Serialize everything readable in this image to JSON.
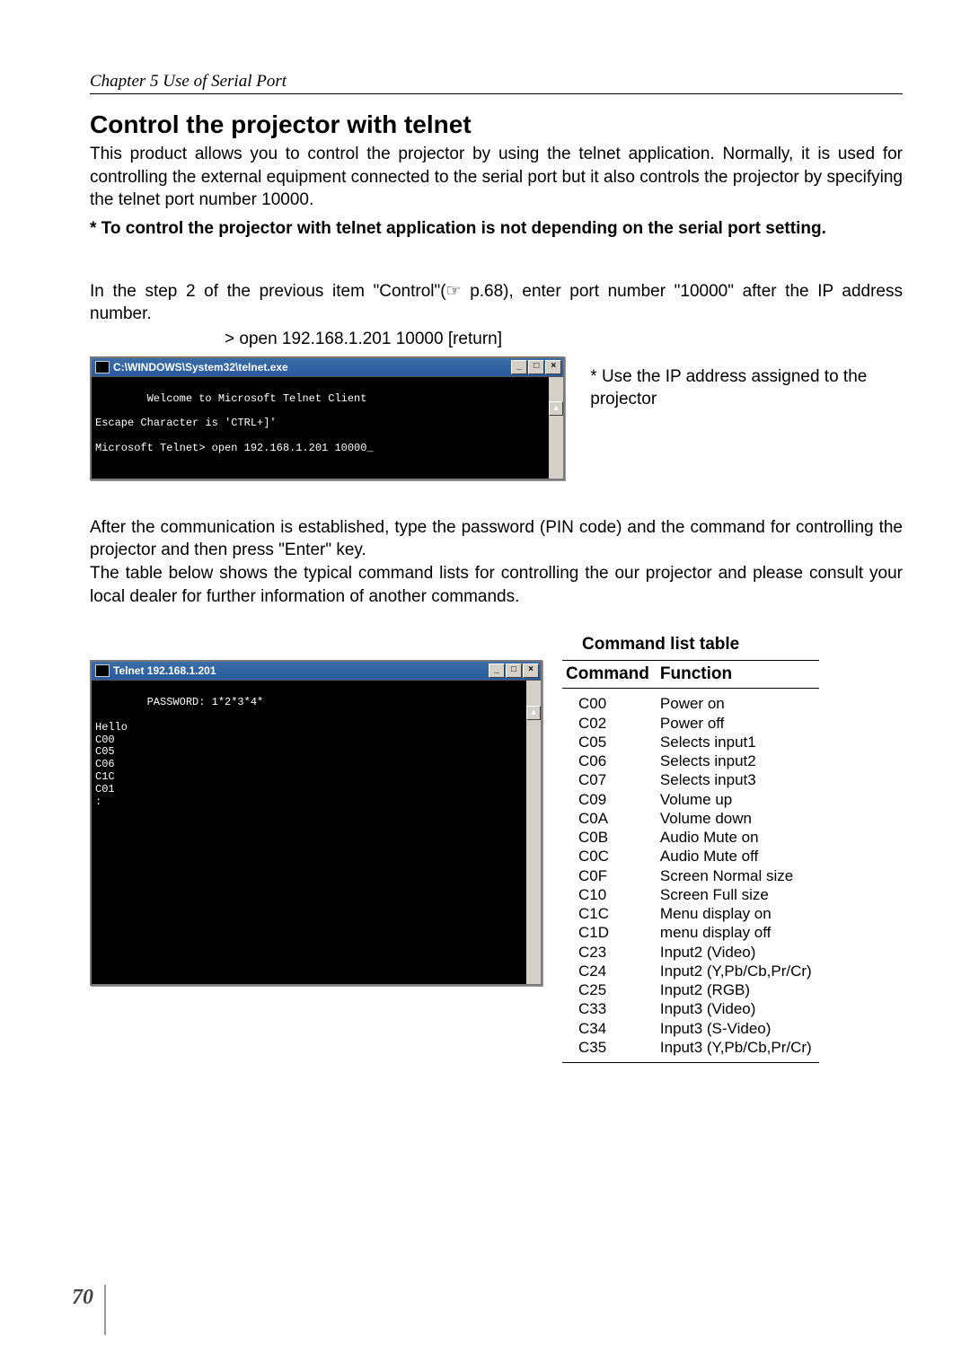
{
  "chapter": "Chapter 5 Use of Serial Port",
  "heading": "Control the projector with telnet",
  "intro": "This product allows you to control the projector by using the telnet application. Normally, it is used for controlling the external equipment connected to the serial port but it also controls the projector by specifying the telnet port number 10000.",
  "note_bold": "* To control the projector with telnet application is not depending on the serial port setting.",
  "step_para": "In the step 2 of the previous item \"Control\"(☞ p.68), enter port number \"10000\" after the IP address number.",
  "cmd_example": "> open 192.168.1.201 10000 [return]",
  "aside_ip": "* Use the IP address assigned to the projector",
  "win1": {
    "title": "C:\\WINDOWS\\System32\\telnet.exe",
    "lines": "Welcome to Microsoft Telnet Client\n\nEscape Character is 'CTRL+]'\n\nMicrosoft Telnet> open 192.168.1.201 10000_"
  },
  "after1": "After the communication is established, type the password (PIN code) and the command for controlling the projector and then press \"Enter\" key.",
  "after2": "The table below shows the typical command lists for controlling the our projector and please consult your local dealer for further information of another commands.",
  "table_caption": "Command list table",
  "win2": {
    "title": "Telnet 192.168.1.201",
    "lines": "PASSWORD: 1*2*3*4*\n\nHello\nC00\nC05\nC06\nC1C\nC01\n:"
  },
  "table": {
    "head_cmd": "Command",
    "head_fn": "Function",
    "rows": [
      {
        "cmd": "C00",
        "fn": "Power on"
      },
      {
        "cmd": "C02",
        "fn": "Power off"
      },
      {
        "cmd": "C05",
        "fn": "Selects input1"
      },
      {
        "cmd": "C06",
        "fn": "Selects input2"
      },
      {
        "cmd": "C07",
        "fn": "Selects input3"
      },
      {
        "cmd": "C09",
        "fn": "Volume up"
      },
      {
        "cmd": "C0A",
        "fn": "Volume down"
      },
      {
        "cmd": "C0B",
        "fn": "Audio Mute on"
      },
      {
        "cmd": "C0C",
        "fn": "Audio Mute off"
      },
      {
        "cmd": "C0F",
        "fn": "Screen Normal size"
      },
      {
        "cmd": "C10",
        "fn": "Screen Full size"
      },
      {
        "cmd": "C1C",
        "fn": "Menu display on"
      },
      {
        "cmd": "C1D",
        "fn": "menu display off"
      },
      {
        "cmd": "C23",
        "fn": "Input2 (Video)"
      },
      {
        "cmd": "C24",
        "fn": "Input2 (Y,Pb/Cb,Pr/Cr)"
      },
      {
        "cmd": "C25",
        "fn": "Input2 (RGB)"
      },
      {
        "cmd": "C33",
        "fn": "Input3 (Video)"
      },
      {
        "cmd": "C34",
        "fn": "Input3 (S-Video)"
      },
      {
        "cmd": "C35",
        "fn": "Input3 (Y,Pb/Cb,Pr/Cr)"
      }
    ]
  },
  "page_number": "70",
  "win_btn": {
    "min": "_",
    "max": "□",
    "close": "×",
    "up": "▲",
    "down": "▼"
  }
}
